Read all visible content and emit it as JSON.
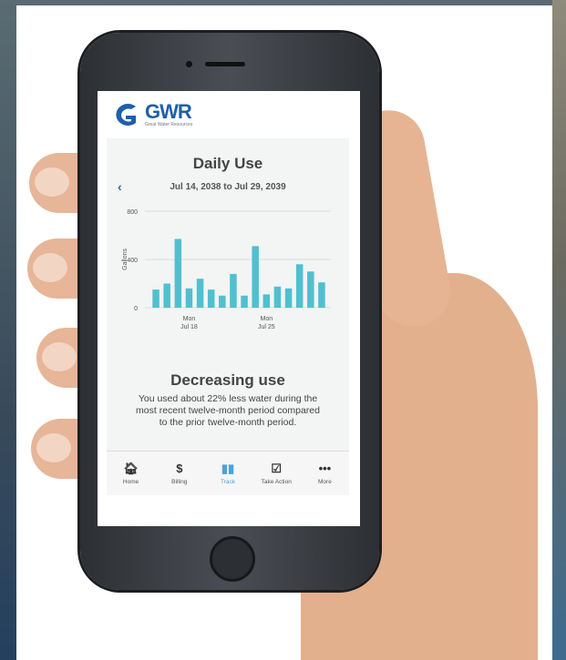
{
  "app": {
    "logo_text": "GWR",
    "logo_subtitle": "Great Water Resources"
  },
  "usage": {
    "title": "Daily Use",
    "date_range": "Jul 14, 2038 to Jul 29, 2039"
  },
  "chart_data": {
    "type": "bar",
    "ylabel": "Gallons",
    "ylim": [
      0,
      800
    ],
    "yticks": [
      "800",
      "400",
      "0"
    ],
    "x_tick_labels": [
      {
        "index": 3,
        "day": "Mon",
        "date": "Jul 18"
      },
      {
        "index": 10,
        "day": "Mon",
        "date": "Jul 25"
      }
    ],
    "values": [
      150,
      200,
      570,
      160,
      240,
      150,
      100,
      280,
      100,
      510,
      110,
      175,
      160,
      360,
      300,
      210
    ],
    "bar_color": "#4fc0cf"
  },
  "summary": {
    "title": "Decreasing use",
    "body": "You used about 22% less water during the most recent twelve-month period compared to the prior twelve-month period."
  },
  "tabs": [
    {
      "label": "Home",
      "icon": "home-icon",
      "glyph": "🏠︎"
    },
    {
      "label": "Billing",
      "icon": "dollar-icon",
      "glyph": "$"
    },
    {
      "label": "Track",
      "icon": "bar-chart-icon",
      "glyph": "▮▮"
    },
    {
      "label": "Take Action",
      "icon": "checklist-icon",
      "glyph": "☑"
    },
    {
      "label": "More",
      "icon": "more-icon",
      "glyph": "•••"
    }
  ],
  "active_tab": "Track"
}
